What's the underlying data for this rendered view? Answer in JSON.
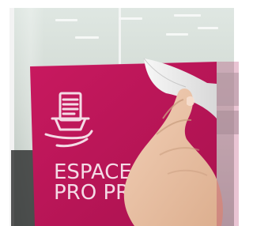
{
  "scene": {
    "sign": {
      "line1": "ESPACE",
      "line2": "PRO PRE",
      "color": "#c3165b",
      "text_color": "#f4dbe6"
    },
    "icon": "shopping-basket-document-icon"
  }
}
